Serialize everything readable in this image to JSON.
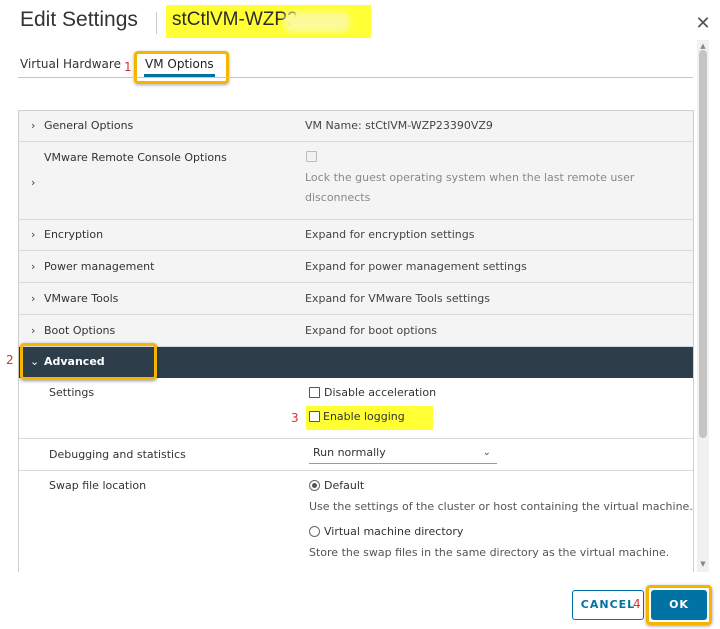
{
  "dialog": {
    "title": "Edit Settings",
    "vm_name_visible": "stCtlVM-WZP2"
  },
  "tabs": [
    {
      "label": "Virtual Hardware"
    },
    {
      "label": "VM Options",
      "active": true
    }
  ],
  "annotations": {
    "step1": "1",
    "step2": "2",
    "step3": "3",
    "step4": "4",
    "highlight_color": "#f4b400",
    "marker_color": "#ffff33",
    "step_color": "#d9342b"
  },
  "rows": {
    "general": {
      "label": "General Options",
      "value": "VM Name: stCtlVM-WZP23390VZ9"
    },
    "vmrc": {
      "label": "VMware Remote Console Options",
      "desc": "Lock the guest operating system when the last remote user disconnects",
      "checkbox_checked": false
    },
    "encryption": {
      "label": "Encryption",
      "value": "Expand for encryption settings"
    },
    "power": {
      "label": "Power management",
      "value": "Expand for power management settings"
    },
    "tools": {
      "label": "VMware Tools",
      "value": "Expand for VMware Tools settings"
    },
    "boot": {
      "label": "Boot Options",
      "value": "Expand for boot options"
    },
    "advanced": {
      "label": "Advanced",
      "expanded": true
    }
  },
  "advanced": {
    "settings_label": "Settings",
    "disable_accel": {
      "label": "Disable acceleration",
      "checked": false
    },
    "enable_logging": {
      "label": "Enable logging",
      "checked": false
    },
    "debug_label": "Debugging and statistics",
    "debug_value": "Run normally",
    "swap_label": "Swap file location",
    "swap_default": {
      "label": "Default",
      "desc": "Use the settings of the cluster or host containing the virtual machine.",
      "checked": true
    },
    "swap_vmdir": {
      "label": "Virtual machine directory",
      "desc": "Store the swap files in the same directory as the virtual machine.",
      "checked": false
    }
  },
  "buttons": {
    "cancel": "CANCEL",
    "ok": "OK"
  },
  "colors": {
    "primary": "#0072a3",
    "advanced_header_bg": "#2d3e4a"
  }
}
